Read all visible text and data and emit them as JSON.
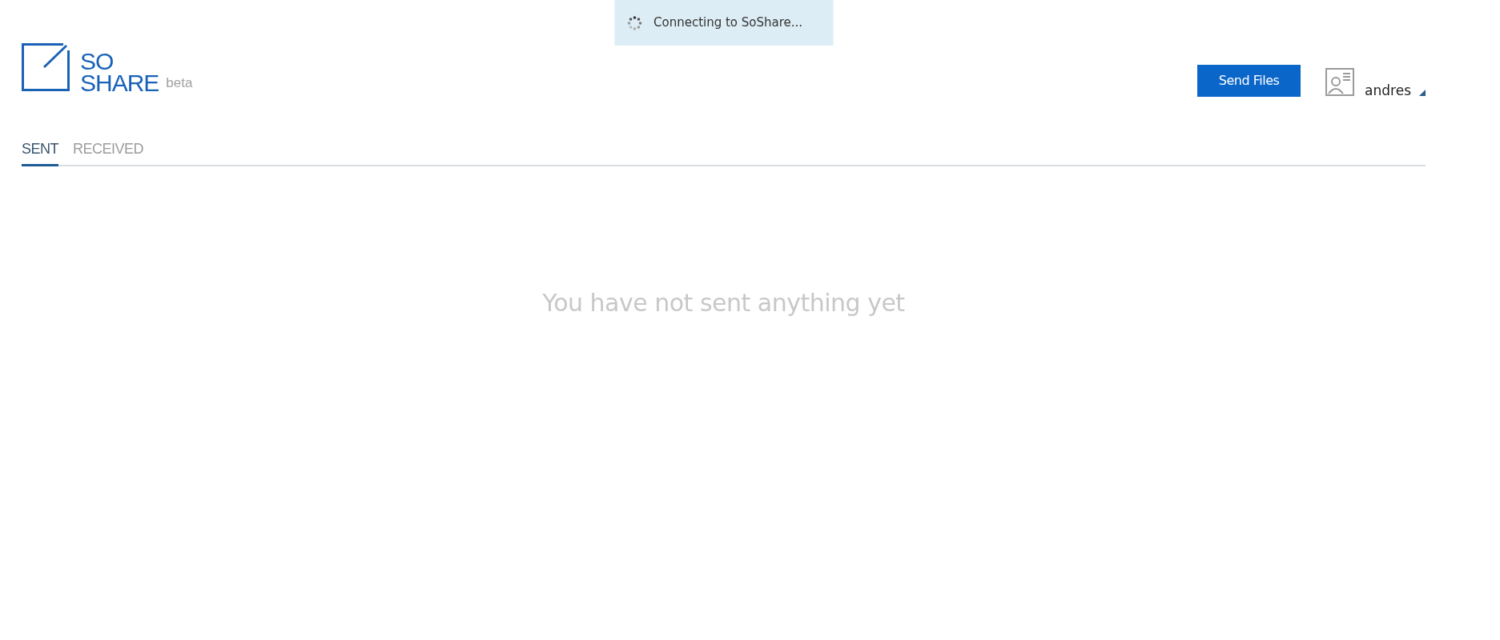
{
  "toast": {
    "text": "Connecting to SoShare..."
  },
  "logo": {
    "lines": [
      "SO",
      "SHARE"
    ],
    "badge": "beta"
  },
  "header": {
    "send_button": "Send Files",
    "user": {
      "name": "andres"
    }
  },
  "tabs": [
    {
      "label": "SENT",
      "selected": true
    },
    {
      "label": "RECEIVED",
      "selected": false
    }
  ],
  "empty_state": {
    "message": "You have not sent anything yet"
  }
}
